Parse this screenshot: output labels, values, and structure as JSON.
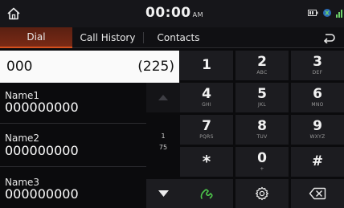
{
  "status": {
    "time": "00:00",
    "ampm": "AM"
  },
  "tabs": [
    {
      "label": "Dial",
      "active": true
    },
    {
      "label": "Call History",
      "active": false
    },
    {
      "label": "Contacts",
      "active": false
    }
  ],
  "dial": {
    "number": "000",
    "match_count": "(225)"
  },
  "contacts": [
    {
      "name": "Name1",
      "phone": "000000000"
    },
    {
      "name": "Name2",
      "phone": "000000000"
    },
    {
      "name": "Name3",
      "phone": "000000000"
    }
  ],
  "scroll": {
    "page": "1",
    "total": "75"
  },
  "keypad": [
    {
      "main": "1",
      "sub": ""
    },
    {
      "main": "2",
      "sub": "ABC"
    },
    {
      "main": "3",
      "sub": "DEF"
    },
    {
      "main": "4",
      "sub": "GHI"
    },
    {
      "main": "5",
      "sub": "JKL"
    },
    {
      "main": "6",
      "sub": "MNO"
    },
    {
      "main": "7",
      "sub": "PQRS"
    },
    {
      "main": "8",
      "sub": "TUV"
    },
    {
      "main": "9",
      "sub": "WXYZ"
    },
    {
      "main": "*",
      "sub": ""
    },
    {
      "main": "0",
      "sub": "+"
    },
    {
      "main": "#",
      "sub": ""
    }
  ],
  "icons": {
    "home": "home-icon",
    "back": "back-arrow-icon",
    "call": "phone-handset-icon",
    "settings": "gear-icon",
    "delete": "backspace-icon",
    "bluetooth_status": "phone-connected-icon",
    "battery": "battery-icon",
    "signal": "signal-icon"
  },
  "colors": {
    "active_tab": "#d4501e",
    "call_green": "#4cc24a",
    "field_bg": "#fafafa"
  }
}
